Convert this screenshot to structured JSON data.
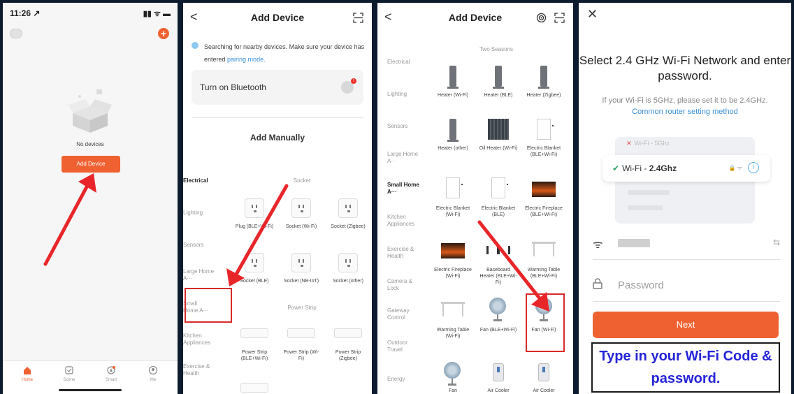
{
  "panel1": {
    "time": "11:26 ↗",
    "status_icons": "▮▮ ᯤ ▬",
    "plus": "+",
    "no_devices": "No devices",
    "add_device": "Add Device",
    "tabs": [
      {
        "label": "Home"
      },
      {
        "label": "Scene"
      },
      {
        "label": "Smart"
      },
      {
        "label": "Me"
      }
    ]
  },
  "panel2": {
    "back": "<",
    "title": "Add Device",
    "search_text": "Searching for nearby devices. Make sure your device has entered",
    "search_link": "pairing mode.",
    "bluetooth": "Turn on Bluetooth",
    "badge": "!",
    "add_manually": "Add Manually",
    "categories": [
      "Electrical",
      "Lighting",
      "Sensors",
      "Large Home A···",
      "Small Home A···",
      "Kitchen Appliances",
      "Exercise & Health"
    ],
    "socket_header": "Socket",
    "power_strip_header": "Power Strip",
    "devices": [
      {
        "label": "Plug (BLE+Wi-Fi)"
      },
      {
        "label": "Socket (Wi-Fi)"
      },
      {
        "label": "Socket (Zigbee)"
      },
      {
        "label": "Socket (BLE)"
      },
      {
        "label": "Socket (NB-IoT)"
      },
      {
        "label": "Socket (other)"
      },
      {
        "label": "Power Strip (BLE+Wi-Fi)"
      },
      {
        "label": "Power Strip (Wi-Fi)"
      },
      {
        "label": "Power Strip (Zigbee)"
      }
    ]
  },
  "panel3": {
    "back": "<",
    "title": "Add Device",
    "categories": [
      "Electrical",
      "Lighting",
      "Sensors",
      "Large Home A···",
      "Small Home A···",
      "Kitchen Appliances",
      "Exercise & Health",
      "Camera & Lock",
      "Gateway Control",
      "Outdoor Travel",
      "Energy"
    ],
    "section": "Two Seasons",
    "devices": [
      {
        "label": "Heater (Wi-Fi)"
      },
      {
        "label": "Heater (BLE)"
      },
      {
        "label": "Heater (Zigbee)"
      },
      {
        "label": "Heater (other)"
      },
      {
        "label": "Oil Heater (Wi-Fi)"
      },
      {
        "label": "Electric Blanket (BLE+Wi-Fi)"
      },
      {
        "label": "Electric Blanket (Wi-Fi)"
      },
      {
        "label": "Electric Blanket (BLE)"
      },
      {
        "label": "Electric Fireplace (BLE+Wi-Fi)"
      },
      {
        "label": "Electric Fireplace (Wi-Fi)"
      },
      {
        "label": "Baseboard Heater (BLE+Wi-Fi)"
      },
      {
        "label": "Warming Table (BLE+Wi-Fi)"
      },
      {
        "label": "Warming Table (Wi-Fi)"
      },
      {
        "label": "Fan (BLE+Wi-Fi)"
      },
      {
        "label": "Fan (Wi-Fi)"
      },
      {
        "label": "Fan"
      },
      {
        "label": "Air Cooler"
      },
      {
        "label": "Air Cooler"
      }
    ]
  },
  "panel4": {
    "close": "✕",
    "title": "Select 2.4 GHz Wi-Fi Network and enter password.",
    "subtitle": "If your Wi-Fi is 5GHz, please set it to be 2.4GHz.",
    "subtitle_link": "Common router setting method",
    "wifi5_label": "Wi-Fi - 5Ghz",
    "wifi24_prefix": "Wi-Fi - ",
    "wifi24_band": "2.4Ghz",
    "password_placeholder": "Password",
    "next": "Next",
    "callout": "Type in your Wi-Fi Code & password."
  },
  "colors": {
    "accent": "#f06132",
    "link": "#3a8fd8",
    "annotation_red": "#e8262a",
    "callout_text": "#2424d8",
    "background": "#0d1b2e"
  }
}
